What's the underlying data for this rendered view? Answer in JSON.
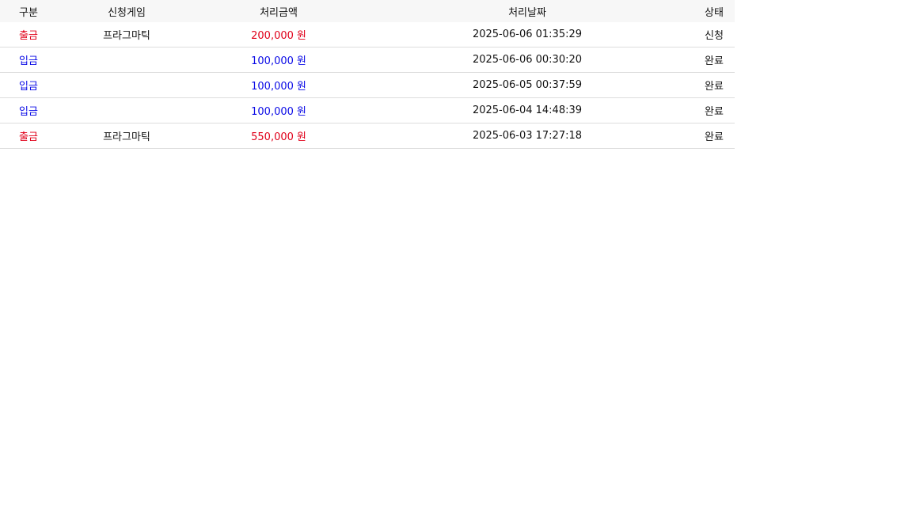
{
  "colors": {
    "withdraw": "#e0001a",
    "deposit": "#0a0ae6",
    "header_bg": "#f7f7f7",
    "row_border": "#dddddd"
  },
  "table": {
    "headers": {
      "type": "구분",
      "game": "신청게임",
      "amount": "처리금액",
      "date": "처리날짜",
      "status": "상태"
    },
    "currency_unit": "원",
    "rows": [
      {
        "type": "출금",
        "kind": "withdraw",
        "game": "프라그마틱",
        "amount": "200,000",
        "unit": "원",
        "date": "2025-06-06 01:35:29",
        "status": "신청"
      },
      {
        "type": "입금",
        "kind": "deposit",
        "game": "",
        "amount": "100,000",
        "unit": "원",
        "date": "2025-06-06 00:30:20",
        "status": "완료"
      },
      {
        "type": "입금",
        "kind": "deposit",
        "game": "",
        "amount": "100,000",
        "unit": "원",
        "date": "2025-06-05 00:37:59",
        "status": "완료"
      },
      {
        "type": "입금",
        "kind": "deposit",
        "game": "",
        "amount": "100,000",
        "unit": "원",
        "date": "2025-06-04 14:48:39",
        "status": "완료"
      },
      {
        "type": "출금",
        "kind": "withdraw",
        "game": "프라그마틱",
        "amount": "550,000",
        "unit": "원",
        "date": "2025-06-03 17:27:18",
        "status": "완료"
      }
    ]
  }
}
